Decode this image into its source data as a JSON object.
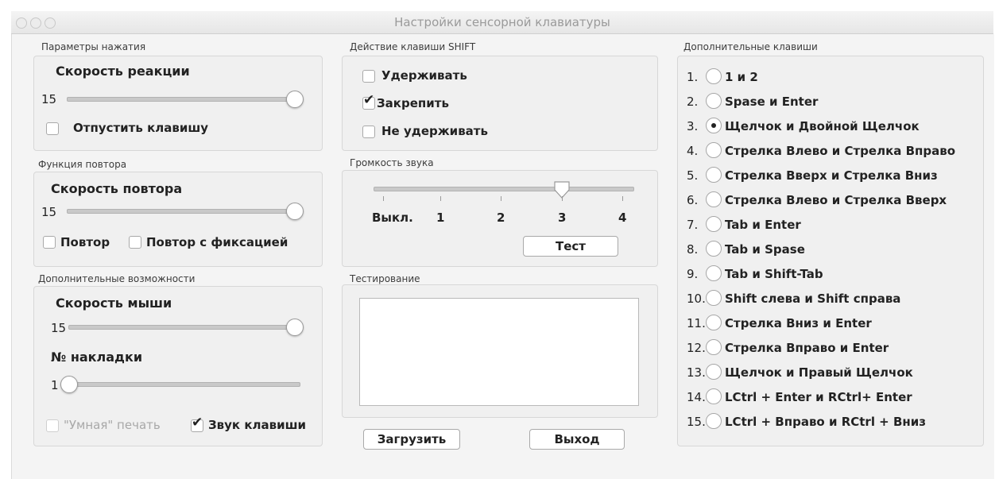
{
  "window": {
    "title": "Настройки сенсорной клавиатуры"
  },
  "press_params": {
    "section_label": "Параметры нажатия",
    "speed_label": "Скорость реакции",
    "speed_value": "15",
    "speed_level": 1.0,
    "release_label": "Отпустить клавишу",
    "release_checked": false
  },
  "repeat": {
    "section_label": "Функция повтора",
    "speed_label": "Скорость повтора",
    "speed_value": "15",
    "speed_level": 1.0,
    "repeat_label": "Повтор",
    "repeat_checked": false,
    "repeat_fixed_label": "Повтор с фиксацией",
    "repeat_fixed_checked": false
  },
  "extra": {
    "section_label": "Дополнительные возможности",
    "mouse_speed_label": "Скорость мыши",
    "mouse_speed_value": "15",
    "mouse_speed_level": 1.0,
    "overlay_label": "№ накладки",
    "overlay_value": "1",
    "overlay_level": 0.0,
    "smart_print_label": "\"Умная\" печать",
    "smart_print_checked": false,
    "smart_print_disabled": true,
    "key_sound_label": "Звук клавиши",
    "key_sound_checked": true
  },
  "shift": {
    "section_label": "Действие клавиши SHIFT",
    "options": [
      {
        "label": "Удерживать",
        "checked": false
      },
      {
        "label": "Закрепить",
        "checked": true
      },
      {
        "label": "Не удерживать",
        "checked": false
      }
    ]
  },
  "volume": {
    "section_label": "Громкость звука",
    "tick_labels": [
      "Выкл.",
      "1",
      "2",
      "3",
      "4"
    ],
    "selected_index": 3,
    "test_button": "Тест"
  },
  "testing": {
    "section_label": "Тестирование",
    "text": ""
  },
  "buttons": {
    "load": "Загрузить",
    "exit": "Выход"
  },
  "extra_keys": {
    "section_label": "Дополнительные клавиши",
    "selected_index": 2,
    "options": [
      {
        "num": "1.",
        "label": "1 и 2"
      },
      {
        "num": "2.",
        "label": "Spase и Enter"
      },
      {
        "num": "3.",
        "label": "Щелчок и Двойной Щелчок"
      },
      {
        "num": "4.",
        "label": "Стрелка Влево и Стрелка Вправо"
      },
      {
        "num": "5.",
        "label": "Стрелка Вверх и Стрелка Вниз"
      },
      {
        "num": "6.",
        "label": "Стрелка Влево и Стрелка Вверх"
      },
      {
        "num": "7.",
        "label": "Tab и Enter"
      },
      {
        "num": "8.",
        "label": "Tab и Spase"
      },
      {
        "num": "9.",
        "label": "Tab и Shift-Tab"
      },
      {
        "num": "10.",
        "label": "Shift слева и Shift справа"
      },
      {
        "num": "11.",
        "label": "Стрелка Вниз и Enter"
      },
      {
        "num": "12.",
        "label": "Стрелка Вправо и Enter"
      },
      {
        "num": "13.",
        "label": "Щелчок и Правый Щелчок"
      },
      {
        "num": "14.",
        "label": "LCtrl + Enter и RCtrl+ Enter"
      },
      {
        "num": "15.",
        "label": "LCtrl + Вправо и RCtrl + Вниз"
      }
    ]
  }
}
